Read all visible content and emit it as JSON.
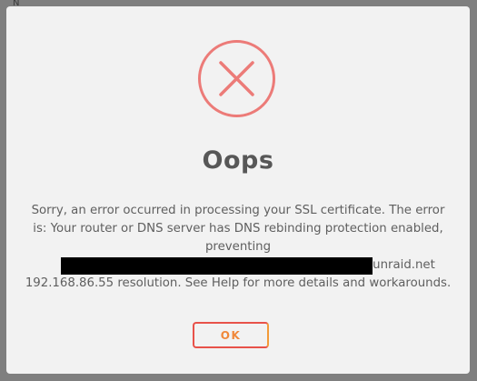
{
  "background": {
    "partial_text": "N"
  },
  "dialog": {
    "icon": "error-x-circle-icon",
    "title": "Oops",
    "message": {
      "line1": "Sorry, an error occurred in processing your SSL certificate. The error",
      "line2": "is: Your router or DNS server has DNS rebinding protection enabled,",
      "line3": "preventing",
      "line4_suffix": "unraid.net",
      "line5": "192.168.86.55 resolution. See Help for more details and workarounds."
    },
    "ok_label": "OK"
  },
  "colors": {
    "icon": "#ec7b78",
    "button_border_start": "#e8524a",
    "button_border_end": "#f39a38",
    "button_text": "#f0883a",
    "dialog_bg": "#f2f2f2",
    "overlay": "#7f7f7f",
    "title": "#575757",
    "body_text": "#5f5f5f"
  }
}
